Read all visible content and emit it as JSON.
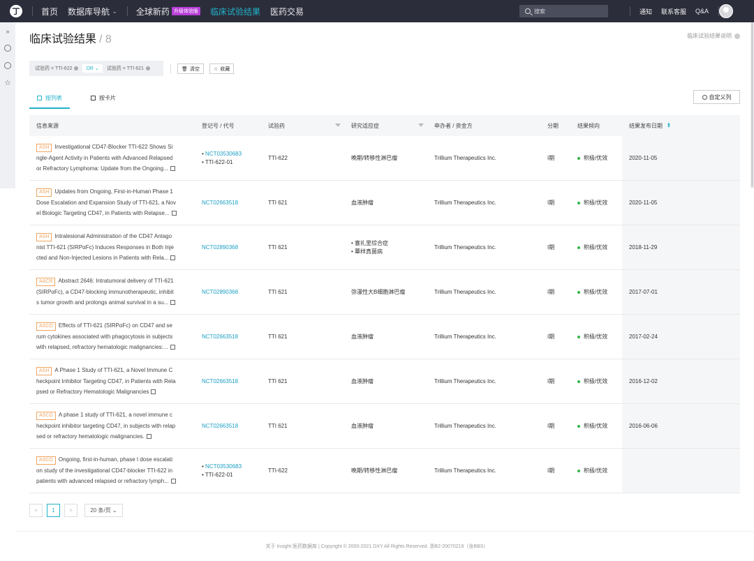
{
  "topbar": {
    "logo": "丁",
    "nav": [
      "首页",
      "数据库导航",
      "全球新药",
      "临床试验结果",
      "医药交易"
    ],
    "nav_caret": "⌄",
    "beta": "升级体验版",
    "search_placeholder": "搜索",
    "links": [
      "通知",
      "联系客服",
      "Q&A"
    ]
  },
  "page": {
    "title": "临床试验结果",
    "count": "/ 8",
    "help": "临床试验结果说明"
  },
  "filters": {
    "chip1": "试验药 = TTI-622",
    "or": "OR",
    "chip2": "试验药 = TTI 621",
    "clear": "清空",
    "save": "收藏"
  },
  "tabs": {
    "list": "按列表",
    "card": "按卡片",
    "custom": "自定义列"
  },
  "table": {
    "headers": [
      "信息来源",
      "登记号 / 代号",
      "试验药",
      "研究适应症",
      "申办者 / 资金方",
      "分期",
      "结果倾向",
      "结果发布日期"
    ],
    "rows": [
      {
        "conf": "ASH",
        "l1": "Investigational CD47-Blocker TTI-622 Shows Si",
        "l2": "ngle-Agent Activity in Patients with Advanced Relapsed",
        "l3": "or Refractory Lymphoma: Update from the Ongoing...",
        "reg1": "NCT03530683",
        "reg2": "TTI-622-01",
        "drug": "TTI-622",
        "ind1": "晚期/转移性淋巴瘤",
        "ind2": "",
        "sponsor": "Trillium Therapeutics Inc.",
        "phase": "I期",
        "result": "积极/优效",
        "date": "2020-11-05"
      },
      {
        "conf": "ASH",
        "l1": "Updates from Ongoing, First-in-Human Phase 1",
        "l2": "Dose Escalation and Expansion Study of TTI-621, a Nov",
        "l3": "el Biologic Targeting CD47, in Patients with Relapse...",
        "reg1": "NCT02663518",
        "reg2": "",
        "drug": "TTI 621",
        "ind1": "血液肿瘤",
        "ind2": "",
        "sponsor": "Trillium Therapeutics Inc.",
        "phase": "I期",
        "result": "积极/优效",
        "date": "2020-11-05"
      },
      {
        "conf": "ASH",
        "l1": "Intralesional Administration of the CD47 Antago",
        "l2": "nist TTI-621 (SIRPαFc) Induces Responses in Both Inje",
        "l3": "cted and Non-Injected Lesions in Patients with Rela...",
        "reg1": "NCT02890368",
        "reg2": "",
        "drug": "TTI 621",
        "ind1": "塞扎里综合症",
        "ind2": "蕈样真菌病",
        "sponsor": "Trillium Therapeutics Inc.",
        "phase": "I期",
        "result": "积极/优效",
        "date": "2018-11-29"
      },
      {
        "conf": "AACR",
        "l1": "Abstract 2646: Intratumoral delivery of TTI-621",
        "l2": "(SIRPαFc), a CD47-blocking immunotherapeutic, inhibit",
        "l3": "s tumor growth and prolongs animal survival in a su...",
        "reg1": "NCT02890368",
        "reg2": "",
        "drug": "TTI 621",
        "ind1": "弥漫性大B细胞淋巴瘤",
        "ind2": "",
        "sponsor": "Trillium Therapeutics Inc.",
        "phase": "I期",
        "result": "积极/优效",
        "date": "2017-07-01"
      },
      {
        "conf": "ASCO",
        "l1": "Effects of TTI-621 (SIRPαFc) on CD47 and se",
        "l2": "rum cytokines associated with phagocytosis in subjects",
        "l3": "with relapsed, refractory hematologic malignancies:...",
        "reg1": "NCT02663518",
        "reg2": "",
        "drug": "TTI 621",
        "ind1": "血液肿瘤",
        "ind2": "",
        "sponsor": "Trillium Therapeutics Inc.",
        "phase": "I期",
        "result": "积极/优效",
        "date": "2017-02-24"
      },
      {
        "conf": "ASH",
        "l1": "A Phase 1 Study of TTI-621, a Novel Immune C",
        "l2": "heckpoint Inhibitor Targeting CD47, in Patients with Rela",
        "l3": "psed or Refractory Hematologic Malignancies",
        "reg1": "NCT02663518",
        "reg2": "",
        "drug": "TTI 621",
        "ind1": "血液肿瘤",
        "ind2": "",
        "sponsor": "Trillium Therapeutics Inc.",
        "phase": "I期",
        "result": "积极/优效",
        "date": "2016-12-02"
      },
      {
        "conf": "ASCO",
        "l1": "A phase 1 study of TTI-621, a novel immune c",
        "l2": "heckpoint inhibitor targeting CD47, in subjects with relap",
        "l3": "sed or refractory hematologic malignancies.",
        "reg1": "NCT02663518",
        "reg2": "",
        "drug": "TTI 621",
        "ind1": "血液肿瘤",
        "ind2": "",
        "sponsor": "Trillium Therapeutics Inc.",
        "phase": "I期",
        "result": "积极/优效",
        "date": "2016-06-06"
      },
      {
        "conf": "ASCO",
        "l1": "Ongoing, first-in-human, phase I dose escalati",
        "l2": "on study of the investigational CD47-blocker TTI-622 in",
        "l3": "patients with advanced relapsed or refractory lymph...",
        "reg1": "NCT03530683",
        "reg2": "TTI-622-01",
        "drug": "TTI-622",
        "ind1": "晚期/转移性淋巴瘤",
        "ind2": "",
        "sponsor": "Trillium Therapeutics Inc.",
        "phase": "I期",
        "result": "积极/优效",
        "date": ""
      }
    ]
  },
  "pagination": {
    "prev": "<",
    "page": "1",
    "next": ">",
    "size": "20 条/页"
  },
  "footer": "关于 Insight 医药数据库  |  Copyright © 2000-2021 DXY All Rights Reserved. 浙B2-20070219（含BBS）",
  "colors": {
    "accent": "#22b2c9",
    "topbar": "#2b2d3a",
    "conf_tag": "#f0a560",
    "positive": "#34b44a"
  }
}
